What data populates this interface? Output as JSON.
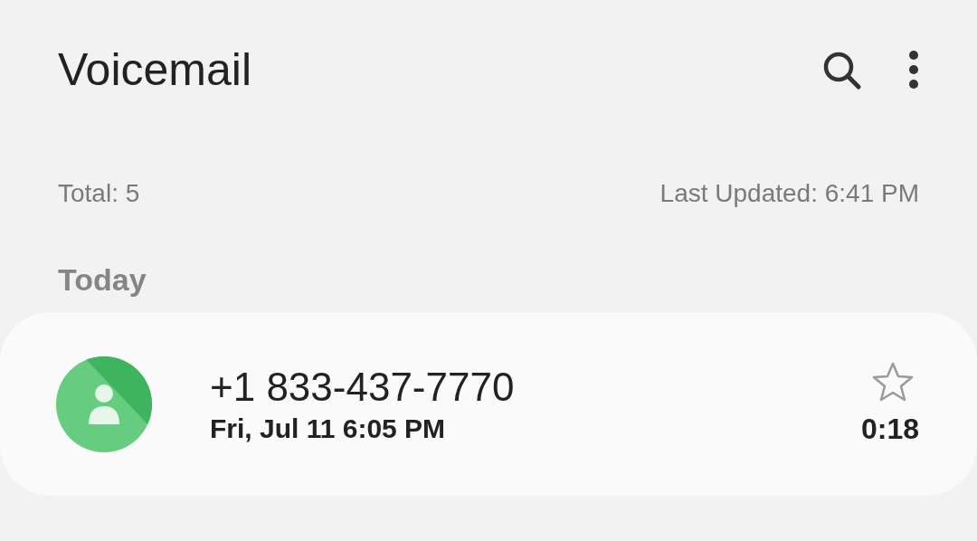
{
  "header": {
    "title": "Voicemail"
  },
  "summary": {
    "total": "Total: 5",
    "last_updated": "Last Updated: 6:41 PM"
  },
  "sections": [
    {
      "heading": "Today",
      "items": [
        {
          "number": "+1 833-437-7770",
          "date": "Fri, Jul 11 6:05 PM",
          "duration": "0:18",
          "starred": false
        }
      ]
    }
  ]
}
